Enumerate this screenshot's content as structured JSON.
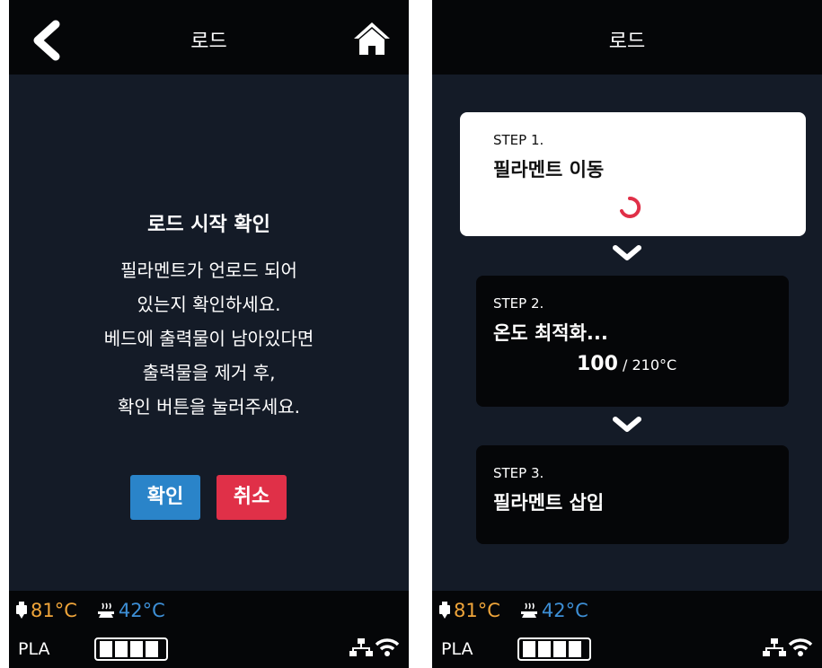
{
  "left": {
    "title": "로드",
    "dialog_title": "로드 시작 확인",
    "message_lines": [
      "필라멘트가 언로드 되어",
      "있는지 확인하세요.",
      "베드에 출력물이 남아있다면",
      "출력물을 제거 후,",
      "확인 버튼을 눌러주세요."
    ],
    "confirm_label": "확인",
    "cancel_label": "취소"
  },
  "right": {
    "title": "로드",
    "steps": [
      {
        "label": "STEP 1.",
        "name": "필라멘트 이동"
      },
      {
        "label": "STEP 2.",
        "name": "온도 최적화...",
        "current_temp": "100",
        "target_temp": " / 210°C"
      },
      {
        "label": "STEP 3.",
        "name": "필라멘트 삽입"
      }
    ]
  },
  "status": {
    "nozzle_temp": "81°C",
    "bed_temp": "42°C",
    "material": "PLA",
    "battery_level": 1.0
  },
  "colors": {
    "background": "#141b27",
    "bar": "#050608",
    "confirm": "#2a84c9",
    "cancel": "#e03048",
    "nozzle": "#f0a53a",
    "bed": "#3d8fd6",
    "spinner": "#e03048"
  },
  "icons": [
    "back-icon",
    "home-icon",
    "nozzle-icon",
    "bed-icon",
    "ethernet-icon",
    "wifi-icon",
    "chevron-down-icon",
    "loading-spinner-icon"
  ]
}
